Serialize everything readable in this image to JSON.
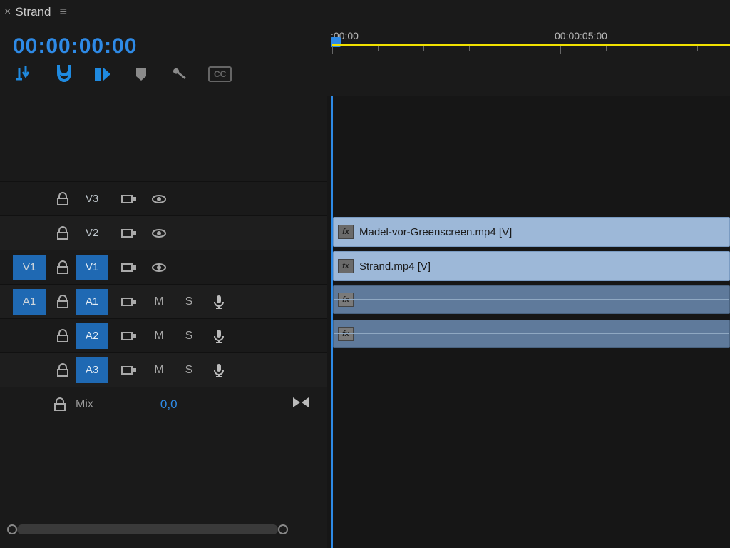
{
  "tab": {
    "close": "×",
    "title": "Strand",
    "menu": "≡"
  },
  "timecode": "00:00:00:00",
  "toolbar": {
    "insert_overwrite": "insert-overwrite",
    "snap": "snap",
    "linked_selection": "linked-selection",
    "marker": "marker",
    "settings": "settings",
    "captions": "CC"
  },
  "ruler": {
    "labels": [
      {
        "text": ":00:00",
        "pos": 0
      },
      {
        "text": "00:00:05:00",
        "pos": 320
      }
    ]
  },
  "tracks": {
    "video": [
      {
        "src": "",
        "src_sel": false,
        "name": "V3",
        "sel": false
      },
      {
        "src": "",
        "src_sel": false,
        "name": "V2",
        "sel": false
      },
      {
        "src": "V1",
        "src_sel": true,
        "name": "V1",
        "sel": true
      }
    ],
    "audio": [
      {
        "src": "A1",
        "src_sel": true,
        "name": "A1",
        "sel": true
      },
      {
        "src": "",
        "src_sel": false,
        "name": "A2",
        "sel": true
      },
      {
        "src": "",
        "src_sel": false,
        "name": "A3",
        "sel": true
      }
    ],
    "mix": {
      "label": "Mix",
      "value": "0,0"
    },
    "labels": {
      "M": "M",
      "S": "S"
    }
  },
  "clips": {
    "v2": {
      "label": "Madel-vor-Greenscreen.mp4 [V]",
      "fx": "fx"
    },
    "v1": {
      "label": "Strand.mp4 [V]",
      "fx": "fx"
    },
    "a1": {
      "fx": "fx"
    },
    "a2": {
      "fx": "fx"
    }
  }
}
